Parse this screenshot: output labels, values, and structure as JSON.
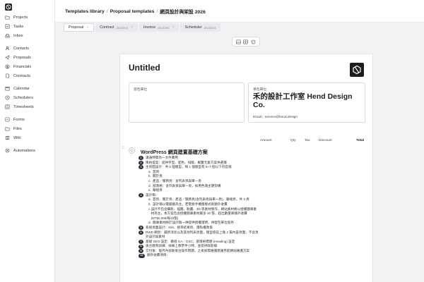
{
  "sidebar": {
    "items": [
      {
        "label": "Projects",
        "icon": "folder-icon"
      },
      {
        "label": "Tasks",
        "icon": "check-square-icon"
      },
      {
        "label": "Inbox",
        "icon": "inbox-icon"
      },
      {
        "label": "Contacts",
        "icon": "user-icon"
      },
      {
        "label": "Proposals",
        "icon": "send-icon"
      },
      {
        "label": "Financials",
        "icon": "dollar-icon"
      },
      {
        "label": "Contracts",
        "icon": "document-icon"
      },
      {
        "label": "Calendar",
        "icon": "calendar-icon"
      },
      {
        "label": "Schedulers",
        "icon": "clock-icon"
      },
      {
        "label": "Timesheets",
        "icon": "timesheet-icon"
      },
      {
        "label": "Forms",
        "icon": "form-icon"
      },
      {
        "label": "Files",
        "icon": "file-icon"
      },
      {
        "label": "Wiki",
        "icon": "book-icon"
      },
      {
        "label": "Automations",
        "icon": "automation-icon"
      }
    ]
  },
  "breadcrumb": {
    "items": [
      "Templates library",
      "Proposal templates",
      "網頁設計與架設 2026"
    ],
    "separator": "/"
  },
  "steps": [
    {
      "label": "Proposal",
      "badge": ""
    },
    {
      "label": "Contract",
      "badge": "disabled"
    },
    {
      "label": "Invoice",
      "badge": "disabled"
    },
    {
      "label": "Scheduler",
      "badge": "disabled"
    }
  ],
  "document": {
    "title": "Untitled",
    "from_label": "發包單位",
    "to_label": "承包單位",
    "company_name": "禾的設計工作室 Hend Design Co.",
    "email": "Email：service@hend.design",
    "columns": {
      "amount": "Amount",
      "qty": "Qty",
      "tax": "Tax",
      "discount": "Discount",
      "total": "Total"
    },
    "item_title": "WordPress 網頁建置基礎方案",
    "lines": {
      "l1": "溝通時間為一文件費用",
      "l2": "風格提案：提供字型、配色、排版，概覽元素方案供選擇",
      "l3": "主頁面設計：共 5 個版型，每 1 個版型有 5~7 個以下的區塊",
      "l3a": "首頁",
      "l3b": "關於頁",
      "l3c": "產品／服務頁：含列表頁與單一頁",
      "l3d": "部落格：含列表頁與單一頁，採用色塊主題架構",
      "l3e": "聯絡頁",
      "l4": "設計稿：",
      "l4a": "首頁、關於頁、產品／服務頁(含列表頁與單一頁)、聯絡頁，共 3 頁",
      "l4b": "設計稿以電腦版為主，若需要手機版樣式則額外收費",
      "l4c": "設計不包含攝影、插圖、動畫、3D 等素材製作，網站素材將以授權圖庫素材為主，本方案包含授權圖庫素材最多 20 張，超出數量將額外收費 (NT$2,000/每10張)",
      "l4d": "圖庫素材將於設計稿一併提供授權證明，供發包單位留存",
      "l5": "系統頁面設計：404、搜尋結果頁、隱私權政策",
      "l6": "RWD 網頁：最新消息以及其他列表頁面，僅型值前上幾 2 篇內容頁面，不含頁外設計與素材",
      "l7": "基礎 SEO 設定：串接 GA／GSC，部落格標題 (Heading) 設定",
      "l8": "後台教育訓練：採線上教學半小時，並提供錄影檔",
      "l9": "交付後：個月內協助後台操作問題，之後如需維護建議另配網站維護方案",
      "l10": "額外收費項目："
    }
  }
}
